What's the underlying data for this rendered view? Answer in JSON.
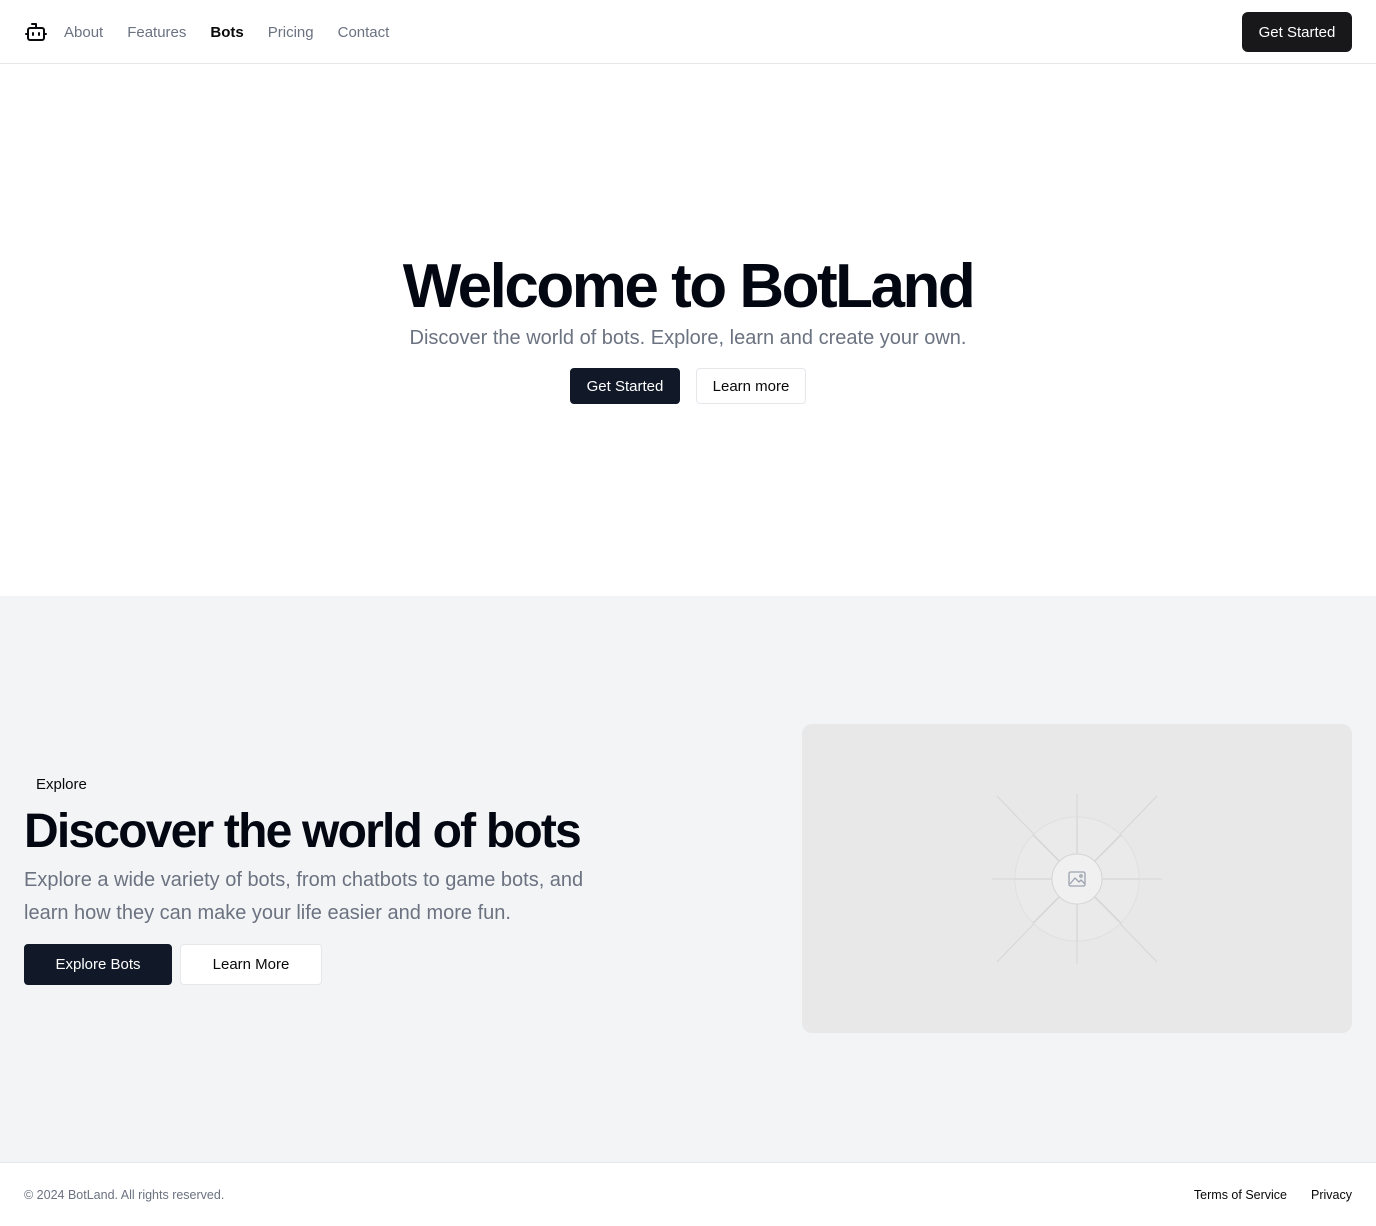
{
  "header": {
    "logo_icon": "bot-icon",
    "nav": [
      {
        "label": "About"
      },
      {
        "label": "Features"
      },
      {
        "label": "Bots",
        "active": true
      },
      {
        "label": "Pricing"
      },
      {
        "label": "Contact"
      }
    ],
    "cta_label": "Get Started"
  },
  "hero": {
    "title": "Welcome to BotLand",
    "subtitle": "Discover the world of bots. Explore, learn and create your own.",
    "primary_label": "Get Started",
    "secondary_label": "Learn more"
  },
  "explore": {
    "tag": "Explore",
    "title": "Discover the world of bots",
    "description": "Explore a wide variety of bots, from chatbots to game bots, and learn how they can make your life easier and more fun.",
    "primary_label": "Explore Bots",
    "secondary_label": "Learn More",
    "image_icon": "image-placeholder-icon"
  },
  "footer": {
    "copyright": "© 2024 BotLand. All rights reserved.",
    "links": [
      {
        "label": "Terms of Service"
      },
      {
        "label": "Privacy"
      }
    ]
  },
  "colors": {
    "primary": "#111827",
    "header_button": "#18181b",
    "muted_text": "#6b7280",
    "section_background": "#f3f4f6",
    "border": "#e5e7eb"
  }
}
